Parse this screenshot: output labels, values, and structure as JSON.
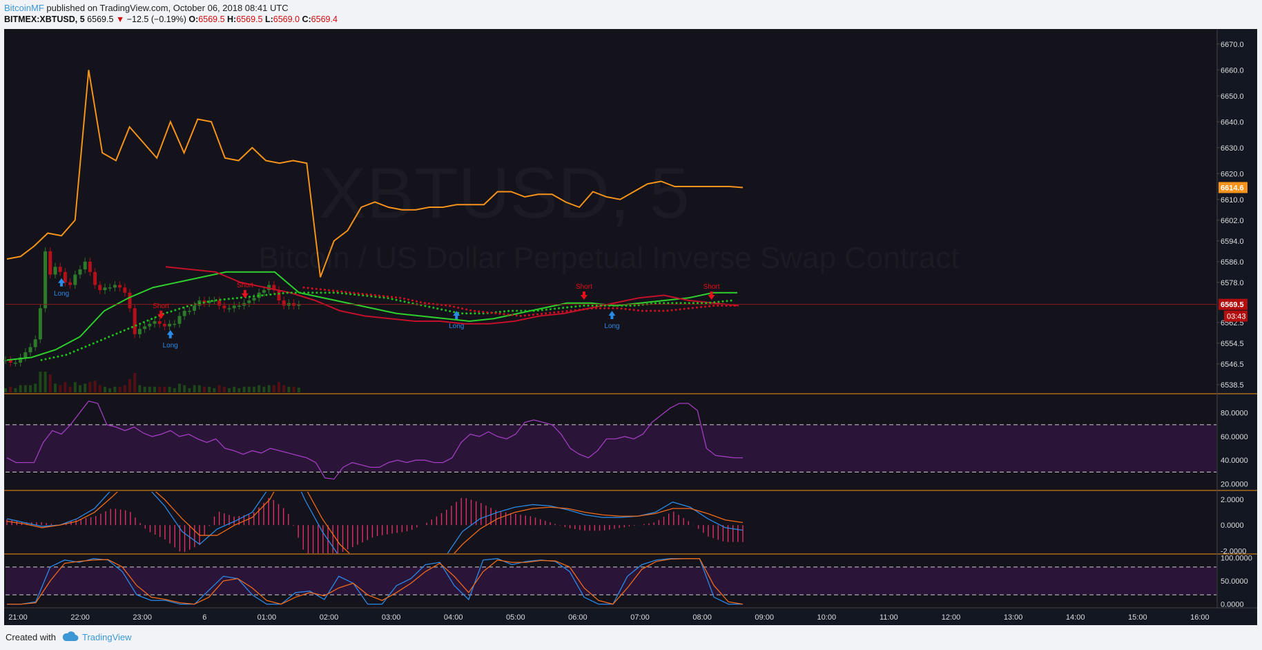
{
  "header": {
    "author": "BitcoinMF",
    "published_text": "published on TradingView.com, October 06, 2018 08:41 UTC",
    "symbol": "BITMEX:XBTUSD, 5",
    "last": "6569.5",
    "change": "−12.5 (−0.19%)",
    "open_label": "O:",
    "open": "6569.5",
    "high_label": "H:",
    "high": "6569.5",
    "low_label": "L:",
    "low": "6569.0",
    "close_label": "C:",
    "close": "6569.4"
  },
  "watermark": {
    "symbol": "XBTUSD, 5",
    "description": "Bitcoin / US Dollar Perpetual Inverse Swap Contract"
  },
  "colors": {
    "background": "#14121a",
    "up": "#2d7a2a",
    "down": "#b3101a",
    "orange": "#f7931a",
    "green_line": "#2ed02e",
    "red_line": "#c4102a",
    "purple": "#8a2ea0",
    "rsi": "#a23cc0",
    "macd": "#2a8ae8",
    "signal": "#f06a1a",
    "hist": "#e0306a",
    "long": "#2a8ae8",
    "short": "#e8101a",
    "pane_border": "#f7931a"
  },
  "chart_data": [
    {
      "type": "candlestick",
      "pane": "price",
      "x_labels": [
        "21:00",
        "22:00",
        "23:00",
        "6",
        "01:00",
        "02:00",
        "03:00",
        "04:00",
        "05:00",
        "06:00",
        "07:00",
        "08:00",
        "09:00",
        "10:00",
        "11:00",
        "12:00",
        "13:00",
        "14:00",
        "15:00",
        "16:00"
      ],
      "ylim": [
        6535,
        6675
      ],
      "y_ticks": [
        "6670.0",
        "6660.0",
        "6650.0",
        "6640.0",
        "6630.0",
        "6620.0",
        "6610.0",
        "6602.0",
        "6594.0",
        "6586.0",
        "6578.0",
        "6562.5",
        "6554.5",
        "6546.5",
        "6538.5"
      ],
      "last_price_label": "6569.5",
      "countdown_label": "03:43",
      "orange_line_label": "6614.6",
      "series": [
        {
          "name": "close",
          "x": [
            0,
            2,
            4,
            6,
            8,
            10,
            12,
            14,
            16,
            18,
            20,
            22,
            24,
            26,
            28,
            30,
            32,
            34,
            36,
            38,
            40,
            42,
            44,
            46,
            48,
            50,
            52,
            54,
            56,
            58,
            60,
            62,
            64,
            66,
            68,
            70,
            72,
            74,
            76,
            78,
            80,
            82,
            84,
            86,
            88,
            90,
            92,
            94,
            96,
            98,
            100,
            102,
            104,
            106,
            108,
            110,
            112,
            114,
            116,
            118
          ],
          "values": [
            6548,
            6547,
            6547,
            6549,
            6551,
            6553,
            6556,
            6568,
            6590,
            6581,
            6584,
            6582,
            6578,
            6577,
            6581,
            6583,
            6586,
            6582,
            6577,
            6575,
            6576,
            6576,
            6577,
            6576,
            6574,
            6568,
            6558,
            6560,
            6561,
            6562,
            6563,
            6562,
            6561,
            6562,
            6562,
            6565,
            6567,
            6567,
            6569,
            6571,
            6570,
            6571,
            6571,
            6569,
            6568,
            6568,
            6569,
            6569,
            6570,
            6571,
            6572,
            6574,
            6575,
            6577,
            6575,
            6571,
            6569,
            6570,
            6569,
            6569.4
          ]
        },
        {
          "name": "orange_line",
          "values": [
            6587,
            6588,
            6592,
            6597,
            6596,
            6602,
            6660,
            6628,
            6625,
            6638,
            6632,
            6626,
            6640,
            6628,
            6641,
            6640,
            6626,
            6625,
            6630,
            6625,
            6624,
            6625,
            6624,
            6580,
            6594,
            6598,
            6607,
            6609,
            6607,
            6606,
            6606,
            6607,
            6607,
            6608,
            6608,
            6608,
            6613,
            6613,
            6611,
            6612,
            6612,
            6609,
            6607,
            6613,
            6611,
            6610,
            6613,
            6616,
            6617,
            6615,
            6615,
            6615,
            6615,
            6615,
            6614.6
          ]
        },
        {
          "name": "green_trend",
          "values": [
            6548,
            6549,
            6552,
            6557,
            6567,
            6572,
            6576,
            6578,
            6580,
            6582,
            6582,
            6582,
            6574,
            6572,
            6570,
            6568,
            6566,
            6565,
            6564,
            6563,
            6564,
            6566,
            6568,
            6570,
            6570,
            6569,
            6570,
            6571,
            6572,
            6574,
            6574
          ]
        },
        {
          "name": "red_trend",
          "values": [
            6584,
            6583,
            6582,
            6578,
            6576,
            6574,
            6571,
            6567,
            6565,
            6564,
            6563,
            6563,
            6562,
            6562,
            6563,
            6565,
            6566,
            6568,
            6570,
            6572,
            6573,
            6571,
            6570,
            6569
          ]
        },
        {
          "name": "green_dots",
          "values": [
            6548,
            6550,
            6554,
            6558,
            6562,
            6566,
            6569,
            6571,
            6572,
            6573,
            6574,
            6574,
            6574,
            6573,
            6572,
            6570,
            6568,
            6566,
            6566,
            6567,
            6567,
            6568,
            6569,
            6569,
            6569,
            6570,
            6570,
            6570,
            6571
          ]
        },
        {
          "name": "red_dots",
          "values": [
            6576,
            6575,
            6574,
            6573,
            6572,
            6570,
            6569,
            6567,
            6566,
            6565,
            6566,
            6567,
            6568,
            6568,
            6567,
            6567,
            6568,
            6569,
            6569
          ]
        }
      ],
      "signals": [
        {
          "label": "Long",
          "x_label": "21:00",
          "at": 0.7
        },
        {
          "label": "Short",
          "x_label": "23:00",
          "at": 2.3
        },
        {
          "label": "Long",
          "x_label": "23:00",
          "at": 2.45
        },
        {
          "label": "Short",
          "x_label": "6",
          "at": 3.65
        },
        {
          "label": "Long",
          "x_label": "04:00",
          "at": 7.05
        },
        {
          "label": "Short",
          "x_label": "06:00",
          "at": 9.1
        },
        {
          "label": "Long",
          "x_label": "06:00",
          "at": 9.55
        },
        {
          "label": "Short",
          "x_label": "08:00",
          "at": 11.15
        }
      ]
    },
    {
      "type": "line",
      "pane": "rsi",
      "ylim": [
        15,
        95
      ],
      "y_ticks": [
        "80.0000",
        "60.0000",
        "40.0000",
        "20.0000"
      ],
      "bands": [
        70,
        30
      ],
      "series": [
        {
          "name": "rsi",
          "values": [
            42,
            38,
            38,
            38,
            55,
            65,
            62,
            70,
            80,
            90,
            88,
            70,
            68,
            65,
            68,
            63,
            60,
            62,
            65,
            60,
            62,
            58,
            55,
            58,
            50,
            48,
            45,
            48,
            46,
            50,
            48,
            46,
            44,
            42,
            38,
            25,
            24,
            34,
            38,
            36,
            34,
            34,
            38,
            40,
            38,
            40,
            40,
            38,
            38,
            42,
            55,
            62,
            60,
            64,
            60,
            58,
            62,
            72,
            74,
            72,
            70,
            62,
            50,
            45,
            42,
            48,
            58,
            58,
            60,
            58,
            62,
            72,
            78,
            84,
            88,
            88,
            82,
            50,
            44,
            43,
            42,
            42
          ]
        }
      ]
    },
    {
      "type": "bar+line",
      "pane": "macd",
      "ylim": [
        -2.2,
        2.6
      ],
      "y_ticks": [
        "2.0000",
        "0.0000",
        "-2.0000"
      ],
      "series": [
        {
          "name": "macd",
          "values": [
            0.5,
            0.2,
            -0.1,
            0.0,
            0.5,
            1.3,
            2.8,
            4,
            3,
            1.5,
            -0.5,
            -1.5,
            -0.3,
            0.3,
            1.0,
            3.0,
            5,
            2.0,
            -0.5,
            -2.5,
            -3.5,
            -3.8,
            -4,
            -4,
            -3.5,
            -2.5,
            -0.5,
            0.5,
            1.0,
            1.4,
            1.6,
            1.5,
            1.2,
            0.8,
            0.6,
            0.6,
            0.7,
            1.0,
            1.8,
            1.4,
            0.5,
            -0.2,
            -0.4
          ]
        },
        {
          "name": "signal",
          "values": [
            0.3,
            0.1,
            -0.2,
            0.0,
            0.3,
            1.0,
            2.2,
            3.5,
            3.2,
            2.0,
            0.5,
            -0.8,
            -0.8,
            0.0,
            0.6,
            2.0,
            4.5,
            3,
            0.5,
            -1.5,
            -2.8,
            -3.4,
            -3.7,
            -3.8,
            -3.6,
            -3.0,
            -1.5,
            -0.3,
            0.5,
            1.0,
            1.3,
            1.4,
            1.3,
            1.0,
            0.8,
            0.7,
            0.7,
            0.9,
            1.3,
            1.3,
            0.9,
            0.4,
            0.2
          ]
        }
      ]
    },
    {
      "type": "line",
      "pane": "stoch",
      "ylim": [
        -5,
        105
      ],
      "y_ticks": [
        "100.0000",
        "50.0000",
        "0.0000"
      ],
      "bands": [
        80,
        20
      ],
      "series": [
        {
          "name": "k",
          "values": [
            0,
            0,
            5,
            80,
            95,
            90,
            98,
            95,
            70,
            20,
            8,
            8,
            0,
            0,
            30,
            60,
            55,
            20,
            0,
            0,
            25,
            28,
            10,
            60,
            45,
            0,
            0,
            40,
            55,
            85,
            90,
            40,
            10,
            95,
            98,
            85,
            92,
            95,
            92,
            70,
            15,
            0,
            0,
            60,
            85,
            95,
            98,
            98,
            98,
            15,
            0,
            0
          ]
        },
        {
          "name": "d",
          "values": [
            0,
            0,
            3,
            50,
            88,
            92,
            95,
            96,
            80,
            40,
            15,
            10,
            3,
            0,
            15,
            50,
            55,
            35,
            8,
            0,
            15,
            25,
            18,
            35,
            45,
            20,
            8,
            25,
            45,
            70,
            88,
            60,
            25,
            70,
            95,
            90,
            90,
            94,
            93,
            80,
            35,
            8,
            0,
            35,
            75,
            92,
            97,
            98,
            98,
            40,
            5,
            0
          ]
        }
      ]
    }
  ],
  "footer": {
    "created_with": "Created with",
    "brand": "TradingView"
  }
}
